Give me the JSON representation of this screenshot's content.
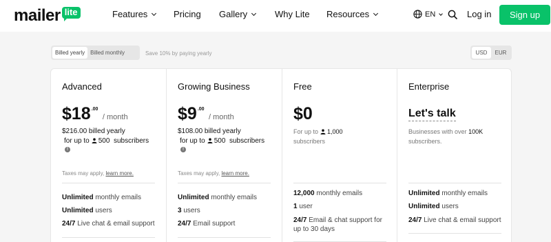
{
  "nav": {
    "logo_text": "mailer",
    "logo_badge": "lite",
    "items": [
      {
        "label": "Features",
        "has_dropdown": true
      },
      {
        "label": "Pricing",
        "has_dropdown": false
      },
      {
        "label": "Gallery",
        "has_dropdown": true
      },
      {
        "label": "Why Lite",
        "has_dropdown": false
      },
      {
        "label": "Resources",
        "has_dropdown": true
      }
    ],
    "language": "EN",
    "login": "Log in",
    "signup": "Sign up"
  },
  "billing": {
    "options": [
      "Billed yearly",
      "Billed monthly"
    ],
    "selected": "Billed yearly",
    "save_note": "Save 10% by paying yearly"
  },
  "currency": {
    "options": [
      "USD",
      "EUR"
    ],
    "selected": "USD"
  },
  "plans": [
    {
      "name": "Advanced",
      "price": "$18",
      "cents": ".00",
      "period": "/ month",
      "billed": "$216.00 billed yearly",
      "subs_prefix": "for up to",
      "subs_count": "500",
      "subs_suffix": "subscribers",
      "tax": "Taxes may apply,",
      "tax_link": "learn more.",
      "features": [
        {
          "bold": "Unlimited",
          "rest": "monthly emails"
        },
        {
          "bold": "Unlimited",
          "rest": "users"
        },
        {
          "bold": "24/7",
          "rest": "Live chat & email support"
        }
      ]
    },
    {
      "name": "Growing Business",
      "price": "$9",
      "cents": ".00",
      "period": "/ month",
      "billed": "$108.00 billed yearly",
      "subs_prefix": "for up to",
      "subs_count": "500",
      "subs_suffix": "subscribers",
      "tax": "Taxes may apply,",
      "tax_link": "learn more.",
      "features": [
        {
          "bold": "Unlimited",
          "rest": "monthly emails"
        },
        {
          "bold": "3",
          "rest": "users"
        },
        {
          "bold": "24/7",
          "rest": "Email support"
        }
      ]
    },
    {
      "name": "Free",
      "price": "$0",
      "subs_prefix": "For up to",
      "subs_count": "1,000",
      "subs_suffix": "subscribers",
      "features": [
        {
          "bold": "12,000",
          "rest": "monthly emails"
        },
        {
          "bold": "1",
          "rest": "user"
        },
        {
          "bold": "24/7",
          "rest": "Email & chat support for",
          "rest2": "up to 30 days"
        }
      ]
    },
    {
      "name": "Enterprise",
      "cta": "Let's talk",
      "desc_prefix": "Businesses with over",
      "desc_bold": "100K",
      "desc_suffix": "subscribers.",
      "features": [
        {
          "bold": "Unlimited",
          "rest": "monthly emails"
        },
        {
          "bold": "Unlimited",
          "rest": "users"
        },
        {
          "bold": "24/7",
          "rest": "Live chat & email support"
        }
      ]
    }
  ],
  "colors": {
    "accent": "#09c269",
    "background": "#f5f5f5"
  }
}
